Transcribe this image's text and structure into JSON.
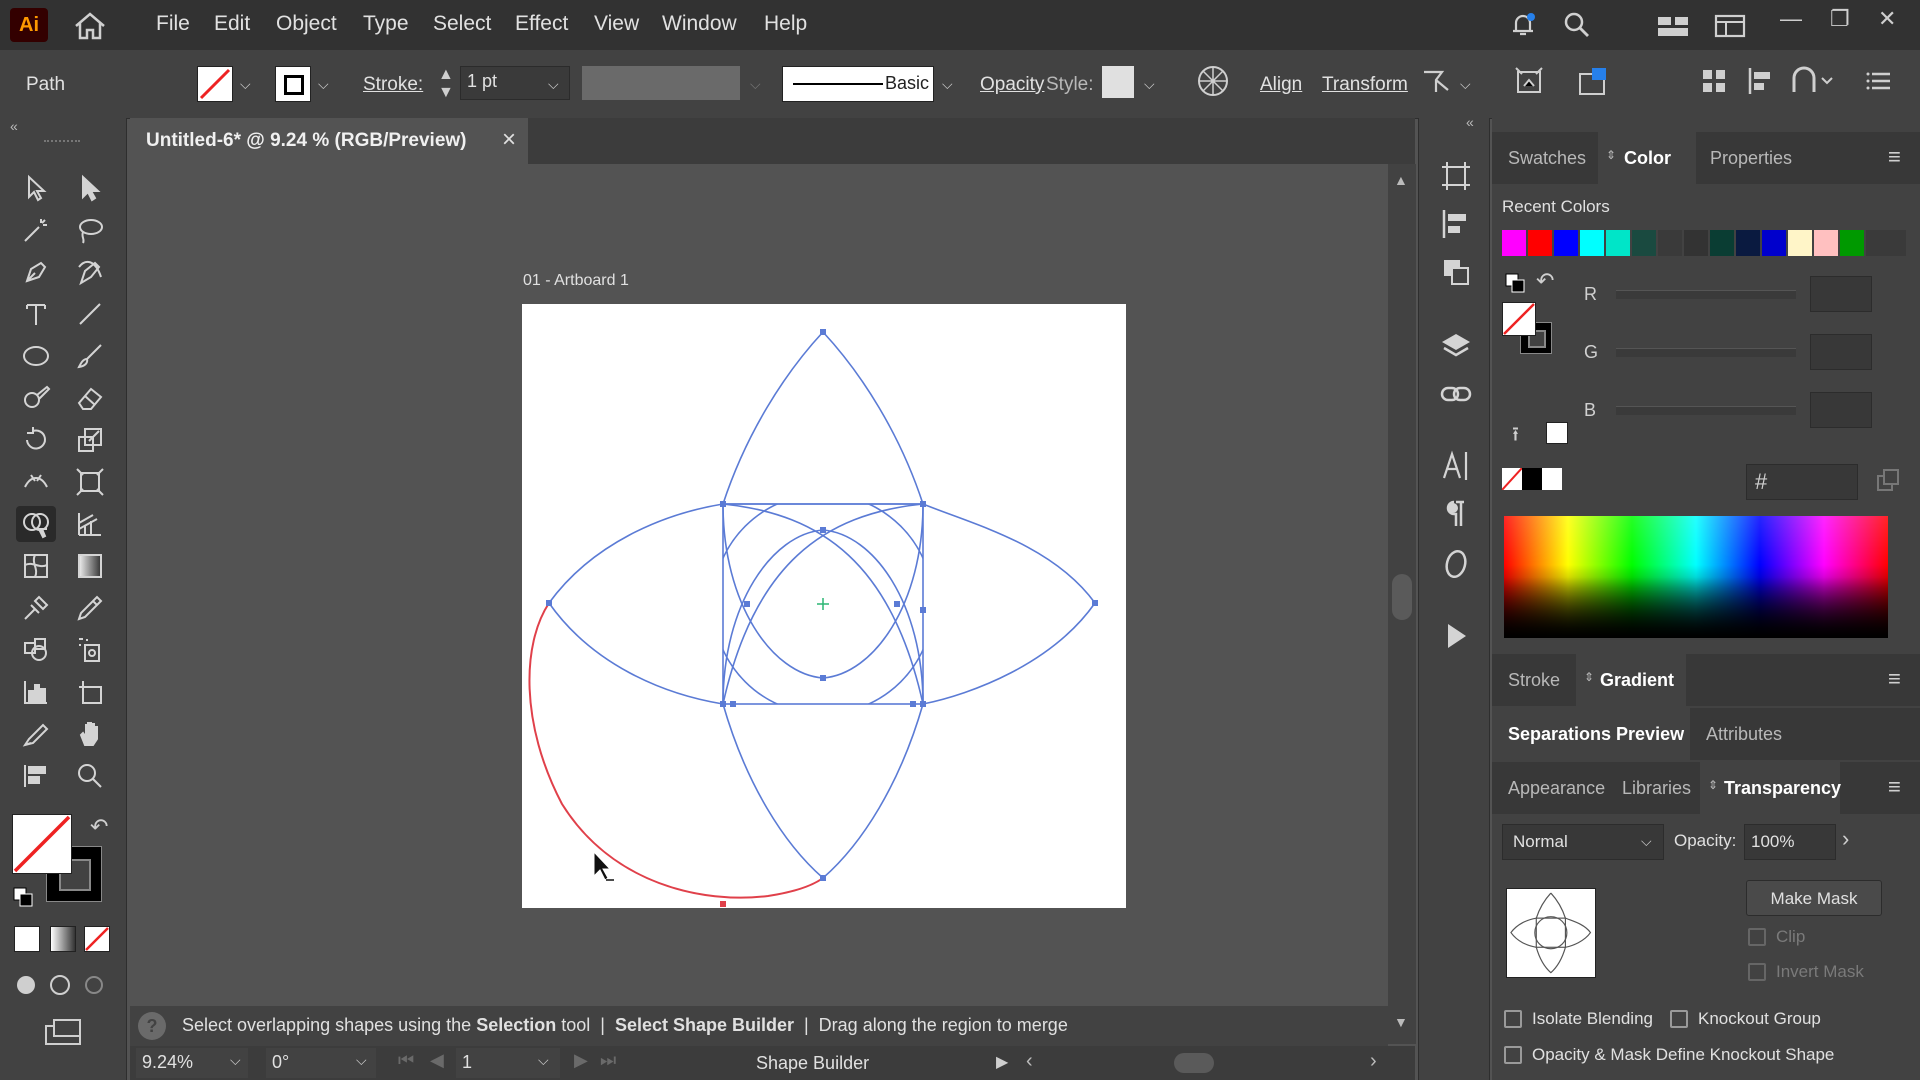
{
  "app": {
    "logo_text": "Ai"
  },
  "menu": [
    "File",
    "Edit",
    "Object",
    "Type",
    "Select",
    "Effect",
    "View",
    "Window",
    "Help"
  ],
  "control_bar": {
    "selection_type": "Path",
    "stroke_label": "Stroke:",
    "stroke_value": "1 pt",
    "brush_label": "Basic",
    "opacity_label": "Opacity",
    "style_label": "Style:",
    "align_label": "Align",
    "transform_label": "Transform"
  },
  "document": {
    "tab_title": "Untitled-6* @ 9.24 % (RGB/Preview)",
    "close_glyph": "×",
    "artboard_label": "01 - Artboard 1"
  },
  "status": {
    "help_glyph": "?",
    "hint_part1": "Select overlapping shapes using the ",
    "hint_bold1": "Selection",
    "hint_part2": " tool  |  ",
    "hint_bold2": "Select Shape Builder",
    "hint_part3": "  |  Drag along the region to merge",
    "zoom": "9.24%",
    "rotation": "0°",
    "artboard_number": "1",
    "current_tool": "Shape Builder"
  },
  "panels": {
    "top_tabs": [
      "Swatches",
      "Color",
      "Properties"
    ],
    "top_selected": "Color",
    "recent_colors_label": "Recent Colors",
    "recent_colors": [
      "#ff00ff",
      "#ff0000",
      "#0000ff",
      "#00ffff",
      "#00e5c8",
      "#1a4a40",
      "#3a3a3a",
      "#333333",
      "#0a3d33",
      "#0a1a40",
      "#0000cc",
      "#fff5c8",
      "#ffc0c0",
      "#009900"
    ],
    "rgb_labels": [
      "R",
      "G",
      "B"
    ],
    "hex_symbol": "#",
    "stroke_tabs": [
      "Stroke",
      "Gradient"
    ],
    "sep_tabs": [
      "Separations Preview",
      "Attributes"
    ],
    "appearance_tabs": [
      "Appearance",
      "Libraries",
      "Transparency"
    ],
    "blend_mode": "Normal",
    "opacity_label": "Opacity:",
    "opacity_value": "100%",
    "make_mask": "Make Mask",
    "clip": "Clip",
    "invert_mask": "Invert Mask",
    "isolate_blending": "Isolate Blending",
    "knockout_group": "Knockout Group",
    "opacity_mask_knockout": "Opacity & Mask Define Knockout Shape"
  },
  "icons": {
    "home": "home-icon",
    "search": "search-icon",
    "notifications": "bell-icon"
  },
  "colors": {
    "path_stroke": "#5b7bd5",
    "highlight_stroke": "#e0404a",
    "ui_dark": "#323232",
    "panel": "#424242"
  }
}
